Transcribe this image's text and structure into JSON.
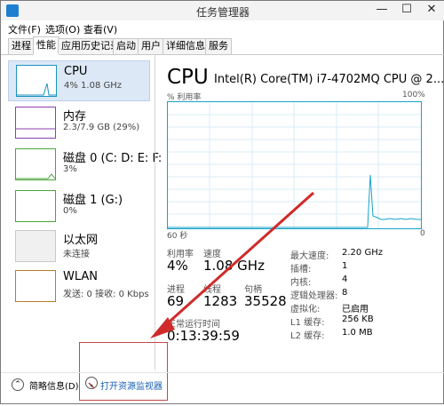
{
  "window": {
    "title": "任务管理器",
    "controls": {
      "minimize": "—",
      "maximize": "☐",
      "close": "✕"
    }
  },
  "menu": [
    "文件(F)",
    "选项(O)",
    "查看(V)"
  ],
  "tabs": [
    {
      "label": "进程"
    },
    {
      "label": "性能"
    },
    {
      "label": "应用历史记录"
    },
    {
      "label": "启动"
    },
    {
      "label": "用户"
    },
    {
      "label": "详细信息"
    },
    {
      "label": "服务"
    }
  ],
  "sidebar": {
    "items": [
      {
        "title": "CPU",
        "subtitle": "4% 1.08 GHz",
        "color": "#1a92c4"
      },
      {
        "title": "内存",
        "subtitle": "2.3/7.9 GB (29%)",
        "color": "#8b3fb0"
      },
      {
        "title": "磁盘 0 (C: D: E: F:",
        "subtitle": "3%",
        "color": "#4aa53b"
      },
      {
        "title": "磁盘 1 (G:)",
        "subtitle": "0%",
        "color": "#4aa53b"
      },
      {
        "title": "以太网",
        "subtitle": "未连接",
        "color": "#b0b0b0"
      },
      {
        "title": "WLAN",
        "subtitle": "发送: 0 接收: 0 Kbps",
        "color": "#b57d2e"
      }
    ]
  },
  "main": {
    "title": "CPU",
    "model": "Intel(R) Core(TM) i7-4702MQ CPU @ 2....",
    "graph": {
      "util_label": "% 利用率",
      "max_label": "100%",
      "time_left": "60 秒",
      "time_right": "0"
    },
    "stats": {
      "utilization_label": "利用率",
      "utilization": "4%",
      "speed_label": "速度",
      "speed": "1.08 GHz",
      "processes_label": "进程",
      "processes": "69",
      "threads_label": "线程",
      "threads": "1283",
      "handles_label": "句柄",
      "handles": "35528",
      "uptime_label": "正常运行时间",
      "uptime": "0:13:39:59"
    },
    "details": [
      {
        "label": "最大速度:",
        "value": "2.20 GHz"
      },
      {
        "label": "插槽:",
        "value": "1"
      },
      {
        "label": "内核:",
        "value": "4"
      },
      {
        "label": "逻辑处理器:",
        "value": "8"
      },
      {
        "label": "虚拟化:",
        "value": "已启用"
      },
      {
        "label": "L1 缓存:",
        "value": "256 KB"
      },
      {
        "label": "L2 缓存:",
        "value": "1.0 MB"
      }
    ]
  },
  "footer": {
    "fewer_details": "简略信息(D)",
    "open_resmon": "打开资源监视器"
  },
  "colors": {
    "graph_line": "#17a2c7",
    "grid": "#d9eef5",
    "link": "#1a5fb4",
    "annotation": "#d02a2a"
  }
}
